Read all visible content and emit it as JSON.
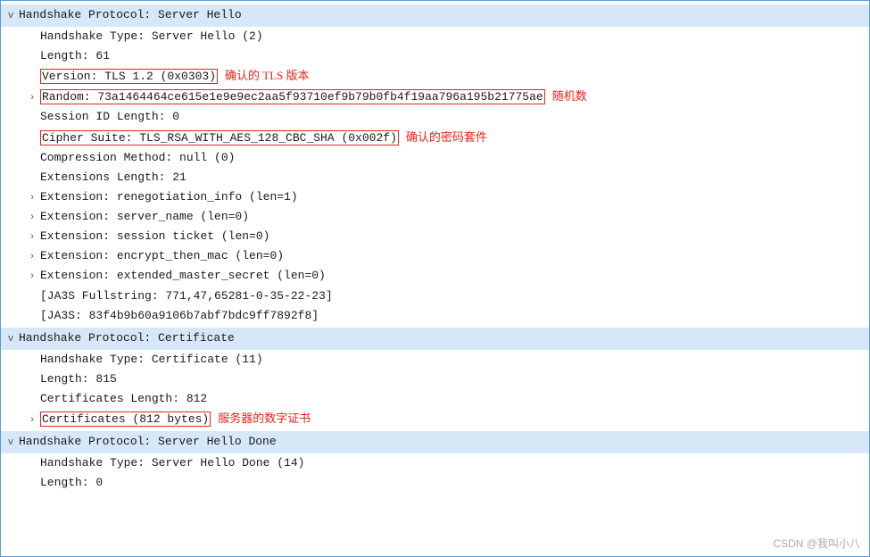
{
  "colors": {
    "header_bg": "#d6e8f7",
    "border": "#5b9bd5",
    "highlight": "#e8231a",
    "text": "#1a1a1a",
    "annotation": "#e8231a"
  },
  "sections": [
    {
      "id": "server-hello",
      "toggle": "v",
      "indent": 0,
      "label": "Handshake Protocol: Server Hello",
      "is_header": true,
      "children": [
        {
          "indent": 1,
          "toggle": "",
          "label": "Handshake Type: Server Hello (2)",
          "highlight": false
        },
        {
          "indent": 1,
          "toggle": "",
          "label": "Length: 61",
          "highlight": false
        },
        {
          "indent": 1,
          "toggle": "",
          "label": "Version: TLS 1.2 (0x0303)",
          "highlight": true,
          "annotation": "确认的 TLS 版本"
        },
        {
          "indent": 1,
          "toggle": ">",
          "label": "Random: 73a1464464ce615e1e9e9ec2aa5f93710ef9b79b0fb4f19aa796a195b21775ae",
          "highlight": true,
          "annotation": "随机数"
        },
        {
          "indent": 1,
          "toggle": "",
          "label": "Session ID Length: 0",
          "highlight": false
        },
        {
          "indent": 1,
          "toggle": "",
          "label": "Cipher Suite: TLS_RSA_WITH_AES_128_CBC_SHA (0x002f)",
          "highlight": true,
          "annotation": "确认的密码套件"
        },
        {
          "indent": 1,
          "toggle": "",
          "label": "Compression Method: null (0)",
          "highlight": false
        },
        {
          "indent": 1,
          "toggle": "",
          "label": "Extensions Length: 21",
          "highlight": false
        },
        {
          "indent": 1,
          "toggle": ">",
          "label": "Extension: renegotiation_info (len=1)",
          "highlight": false
        },
        {
          "indent": 1,
          "toggle": ">",
          "label": "Extension: server_name (len=0)",
          "highlight": false
        },
        {
          "indent": 1,
          "toggle": ">",
          "label": "Extension: session_ticket (len=0)",
          "highlight": false
        },
        {
          "indent": 1,
          "toggle": ">",
          "label": "Extension: encrypt_then_mac (len=0)",
          "highlight": false
        },
        {
          "indent": 1,
          "toggle": ">",
          "label": "Extension: extended_master_secret (len=0)",
          "highlight": false
        },
        {
          "indent": 1,
          "toggle": "",
          "label": "[JA3S Fullstring: 771,47,65281-0-35-22-23]",
          "highlight": false
        },
        {
          "indent": 1,
          "toggle": "",
          "label": "[JA3S: 83f4b9b60a9106b7abf7bdc9ff7892f8]",
          "highlight": false
        }
      ]
    },
    {
      "id": "certificate",
      "toggle": "v",
      "indent": 0,
      "label": "Handshake Protocol: Certificate",
      "is_header": true,
      "children": [
        {
          "indent": 1,
          "toggle": "",
          "label": "Handshake Type: Certificate (11)",
          "highlight": false
        },
        {
          "indent": 1,
          "toggle": "",
          "label": "Length: 815",
          "highlight": false
        },
        {
          "indent": 1,
          "toggle": "",
          "label": "Certificates Length: 812",
          "highlight": false
        },
        {
          "indent": 1,
          "toggle": ">",
          "label": "Certificates (812 bytes)",
          "highlight": true,
          "annotation": "服务器的数字证书"
        }
      ]
    },
    {
      "id": "server-hello-done",
      "toggle": "v",
      "indent": 0,
      "label": "Handshake Protocol: Server Hello Done",
      "is_header": true,
      "children": [
        {
          "indent": 1,
          "toggle": "",
          "label": "Handshake Type: Server Hello Done (14)",
          "highlight": false
        },
        {
          "indent": 1,
          "toggle": "",
          "label": "Length: 0",
          "highlight": false
        }
      ]
    }
  ],
  "watermark": "CSDN @我叫小八"
}
